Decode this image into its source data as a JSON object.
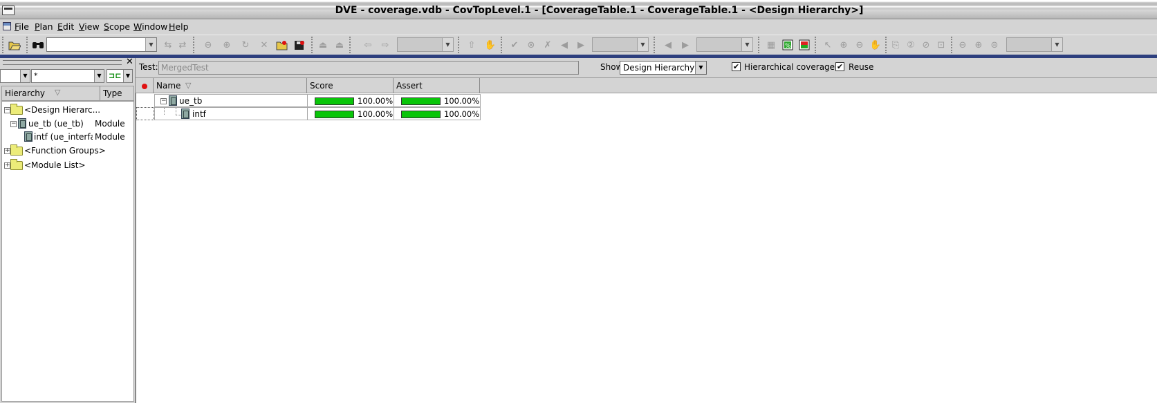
{
  "window": {
    "title": "DVE - coverage.vdb -  CovTopLevel.1 - [CoverageTable.1 - CoverageTable.1 - <Design Hierarchy>]"
  },
  "menu": {
    "items": [
      {
        "label": "File",
        "key": "F",
        "rest": "ile"
      },
      {
        "label": "Plan",
        "key": "P",
        "rest": "lan"
      },
      {
        "label": "Edit",
        "key": "E",
        "rest": "dit"
      },
      {
        "label": "View",
        "key": "V",
        "rest": "iew"
      },
      {
        "label": "Scope",
        "key": "S",
        "rest": "cope"
      },
      {
        "label": "Window",
        "key": "W",
        "rest": "indow"
      },
      {
        "label": "Help",
        "key": "H",
        "rest": "elp"
      }
    ]
  },
  "toolbar": {
    "search_value": ""
  },
  "left_panel": {
    "filter_value": "*",
    "columns": {
      "hierarchy": "Hierarchy",
      "type": "Type"
    },
    "tree": [
      {
        "label": "<Design Hierarc...",
        "type": ""
      },
      {
        "label": "ue_tb (ue_tb)",
        "type": "Module"
      },
      {
        "label": "intf (ue_interfa...",
        "type": "Module"
      },
      {
        "label": "<Function Groups>",
        "type": ""
      },
      {
        "label": "<Module List>",
        "type": ""
      }
    ]
  },
  "main": {
    "test_label": "Test:",
    "test_value": "MergedTest",
    "show_label": "Show:",
    "show_value": "Design Hierarchy",
    "hier_cov_label": "Hierarchical coverage",
    "hier_cov_checked": true,
    "reuse_label": "Reuse",
    "reuse_checked": true,
    "columns": {
      "name": "Name",
      "score": "Score",
      "assert": "Assert"
    },
    "rows": [
      {
        "name": "ue_tb",
        "score": "100.00%",
        "score_value": 1.0,
        "assert": "100.00%",
        "assert_value": 1.0
      },
      {
        "name": "intf",
        "score": "100.00%",
        "score_value": 1.0,
        "assert": "100.00%",
        "assert_value": 1.0
      }
    ]
  },
  "colors": {
    "title_accent": "#2d3f7e",
    "bar_fill": "#09c509",
    "marker": "#e01010"
  }
}
